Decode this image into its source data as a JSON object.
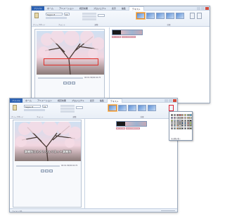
{
  "app": {
    "file_tab": "ファイル"
  },
  "tabs": [
    "ホーム",
    "アニメーション",
    "視覚効果",
    "プロジェクト",
    "表示",
    "編集",
    "テキスト"
  ],
  "ribbon": {
    "groups": [
      "クリップボード",
      "フォント",
      "段落",
      "調整",
      "効果"
    ],
    "font_name": "Segoe UI",
    "font_size": "16"
  },
  "window1": {
    "caption": "",
    "time": "00:01.30/00:04.70",
    "clip_tags": [
      "テキスト",
      "ロミオとジュリエット"
    ]
  },
  "window2": {
    "caption": "満開桜ロミオとジュリエット満開桜",
    "time": "00:01.30/00:04.70",
    "clip_tags": [
      "テキスト",
      "ロミオとジュリエット"
    ],
    "status": "アイテム 1/1"
  },
  "palette": {
    "colors": [
      "#000000",
      "#7f7f7f",
      "#880015",
      "#ed1c24",
      "#ff7f27",
      "#fff200",
      "#22b14c",
      "#00a2e8",
      "#3f48cc",
      "#a349a4",
      "#ffffff",
      "#c3c3c3",
      "#b97a57",
      "#ffaec9",
      "#ffc90e",
      "#efe4b0",
      "#b5e61d",
      "#99d9ea",
      "#7092be",
      "#c8bfe7",
      "#404040",
      "#595959",
      "#262626",
      "#0d0d0d",
      "#d9d9d9",
      "#bfbfbf",
      "#a6a6a6",
      "#8c8c8c",
      "#1f497d",
      "#4f81bd",
      "#c0504d",
      "#9bbb59",
      "#8064a2",
      "#4bacc6",
      "#f79646",
      "#eeece1",
      "#17365d",
      "#366092",
      "#953734",
      "#76923c",
      "#5f497a",
      "#31859b",
      "#e36c09",
      "#948a54",
      "#0f243e",
      "#244061",
      "#632423",
      "#4f6128"
    ],
    "more_label": "その他の色..."
  },
  "colors": {
    "accent": "#2a60b2",
    "highlight": "#e0302a"
  }
}
